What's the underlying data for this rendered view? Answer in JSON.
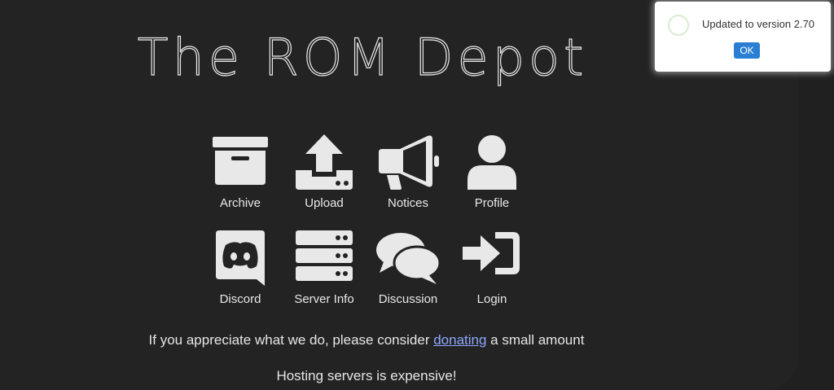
{
  "site": {
    "title": "The ROM Depot"
  },
  "menu": {
    "items": [
      {
        "label": "Archive",
        "icon": "archive-box-icon"
      },
      {
        "label": "Upload",
        "icon": "upload-tray-icon"
      },
      {
        "label": "Notices",
        "icon": "megaphone-icon"
      },
      {
        "label": "Profile",
        "icon": "user-profile-icon"
      },
      {
        "label": "Discord",
        "icon": "discord-icon"
      },
      {
        "label": "Server Info",
        "icon": "server-stack-icon"
      },
      {
        "label": "Discussion",
        "icon": "chat-bubbles-icon"
      },
      {
        "label": "Login",
        "icon": "sign-in-icon"
      }
    ]
  },
  "donate": {
    "before": "If you appreciate what we do, please consider ",
    "link": "donating",
    "after": " a small amount"
  },
  "hosting_note": "Hosting servers is expensive!",
  "toast": {
    "message": "Updated to version 2.70",
    "ok_label": "OK"
  },
  "colors": {
    "background": "#232323",
    "icon": "#e8e8e8",
    "link": "#8ea8ff",
    "ok_button": "#2a7fd4"
  }
}
